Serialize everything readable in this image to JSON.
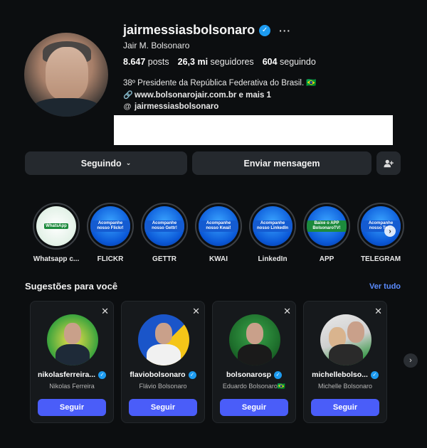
{
  "profile": {
    "username": "jairmessiasbolsonaro",
    "full_name": "Jair M. Bolsonaro",
    "posts": "8.647",
    "posts_label": "posts",
    "followers": "26,3 mi",
    "followers_label": "seguidores",
    "following": "604",
    "following_label": "seguindo",
    "bio": "38º Presidente da República Federativa do Brasil. 🇧🇷",
    "link": "www.bolsonarojair.com.br e mais 1",
    "threads": "jairmessiasbolsonaro",
    "more": "···"
  },
  "actions": {
    "following_label": "Seguindo",
    "message_label": "Enviar mensagem"
  },
  "highlights": [
    {
      "label": "Whatsapp c...",
      "tag": "WhatsApp"
    },
    {
      "label": "FLICKR",
      "tag": "Acompanhe nosso Flickr!"
    },
    {
      "label": "GETTR",
      "tag": "Acompanhe nosso Gettr!"
    },
    {
      "label": "KWAI",
      "tag": "Acompanhe nosso Kwai!"
    },
    {
      "label": "LinkedIn",
      "tag": "Acompanhe nosso LinkedIn"
    },
    {
      "label": "APP",
      "tag": "Baixe o APP BolsonaroTV!"
    },
    {
      "label": "TELEGRAM",
      "tag": "Acompanhe nosso Tel..."
    }
  ],
  "suggestions": {
    "title": "Sugestões para você",
    "see_all": "Ver tudo",
    "close": "✕",
    "follow_label": "Seguir",
    "cards": [
      {
        "username": "nikolasferreira...",
        "name": "Nikolas Ferreira"
      },
      {
        "username": "flaviobolsonaro",
        "name": "Flávio Bolsonaro"
      },
      {
        "username": "bolsonarosp",
        "name": "Eduardo Bolsonaro🇧🇷"
      },
      {
        "username": "michellebolso...",
        "name": "Michelle Bolsonaro"
      }
    ]
  },
  "colors": {
    "background": "#0c0e10",
    "verified": "#1d9bf0",
    "follow_button": "#4a5df9",
    "link": "#5b8cff"
  }
}
